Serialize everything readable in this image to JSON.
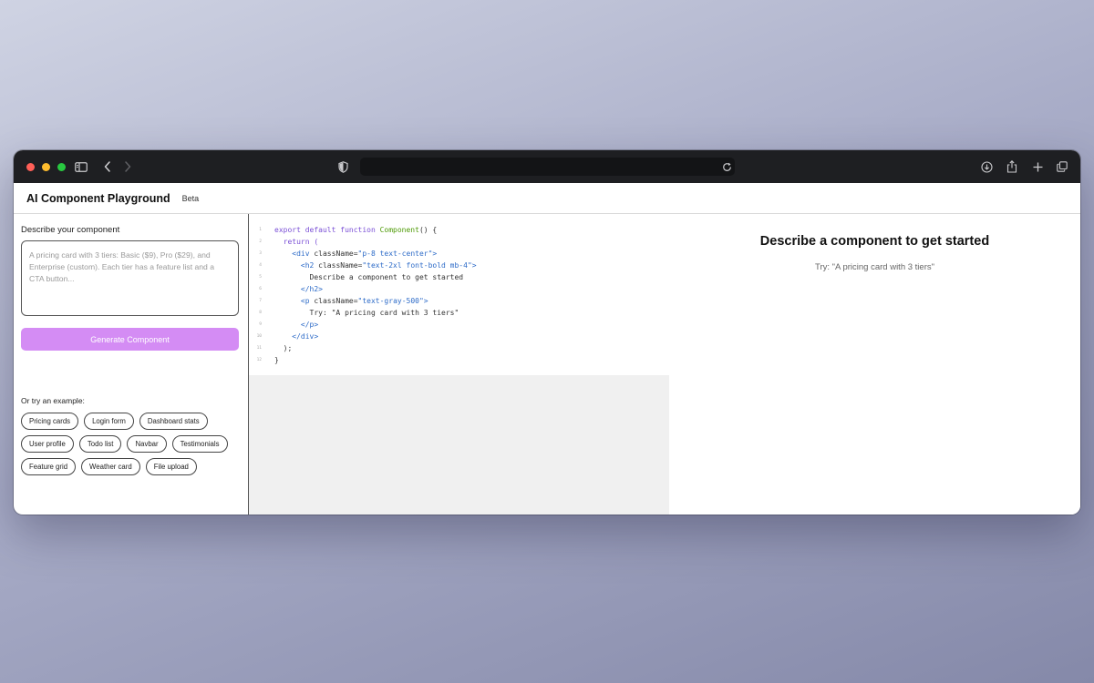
{
  "app": {
    "title": "AI Component Playground",
    "badge": "Beta"
  },
  "left": {
    "label": "Describe your component",
    "placeholder": "A pricing card with 3 tiers: Basic ($9), Pro ($29), and Enterprise (custom). Each tier has a feature list and a CTA button...",
    "generate_label": "Generate Component",
    "examples_label": "Or try an example:",
    "chips_row1": [
      "Pricing cards",
      "Login form",
      "Dashboard stats"
    ],
    "chips_row2": [
      "User profile",
      "Todo list",
      "Navbar",
      "Testimonials"
    ],
    "chips_row3": [
      "Feature grid",
      "Weather card",
      "File upload"
    ]
  },
  "code": {
    "line_numbers": [
      "1",
      "2",
      "3",
      "4",
      "5",
      "6",
      "7",
      "8",
      "9",
      "10",
      "11",
      "12"
    ],
    "l1_kw": "export default function ",
    "l1_fn": "Component",
    "l1_rest": "() {",
    "l2": "  return (",
    "l3_open": "    <div ",
    "l3_attr": "className=",
    "l3_val": "\"p-8 text-center\"",
    "l3_close": ">",
    "l4_open": "      <h2 ",
    "l4_attr": "className=",
    "l4_val": "\"text-2xl font-bold mb-4\"",
    "l4_close": ">",
    "l5": "        Describe a component to get started",
    "l6": "      </h2>",
    "l7_open": "      <p ",
    "l7_attr": "className=",
    "l7_val": "\"text-gray-500\"",
    "l7_close": ">",
    "l8": "        Try: \"A pricing card with 3 tiers\"",
    "l9": "      </p>",
    "l10": "    </div>",
    "l11": "  );",
    "l12": "}"
  },
  "preview": {
    "title": "Describe a component to get started",
    "subtitle": "Try: \"A pricing card with 3 tiers\""
  },
  "colors": {
    "accent": "#d48cf4",
    "titlebar": "#1e1f22"
  },
  "icons": [
    "sidebar-icon",
    "back-icon",
    "forward-icon",
    "shield-icon",
    "reload-icon",
    "download-icon",
    "share-icon",
    "new-tab-icon",
    "tabs-icon"
  ]
}
